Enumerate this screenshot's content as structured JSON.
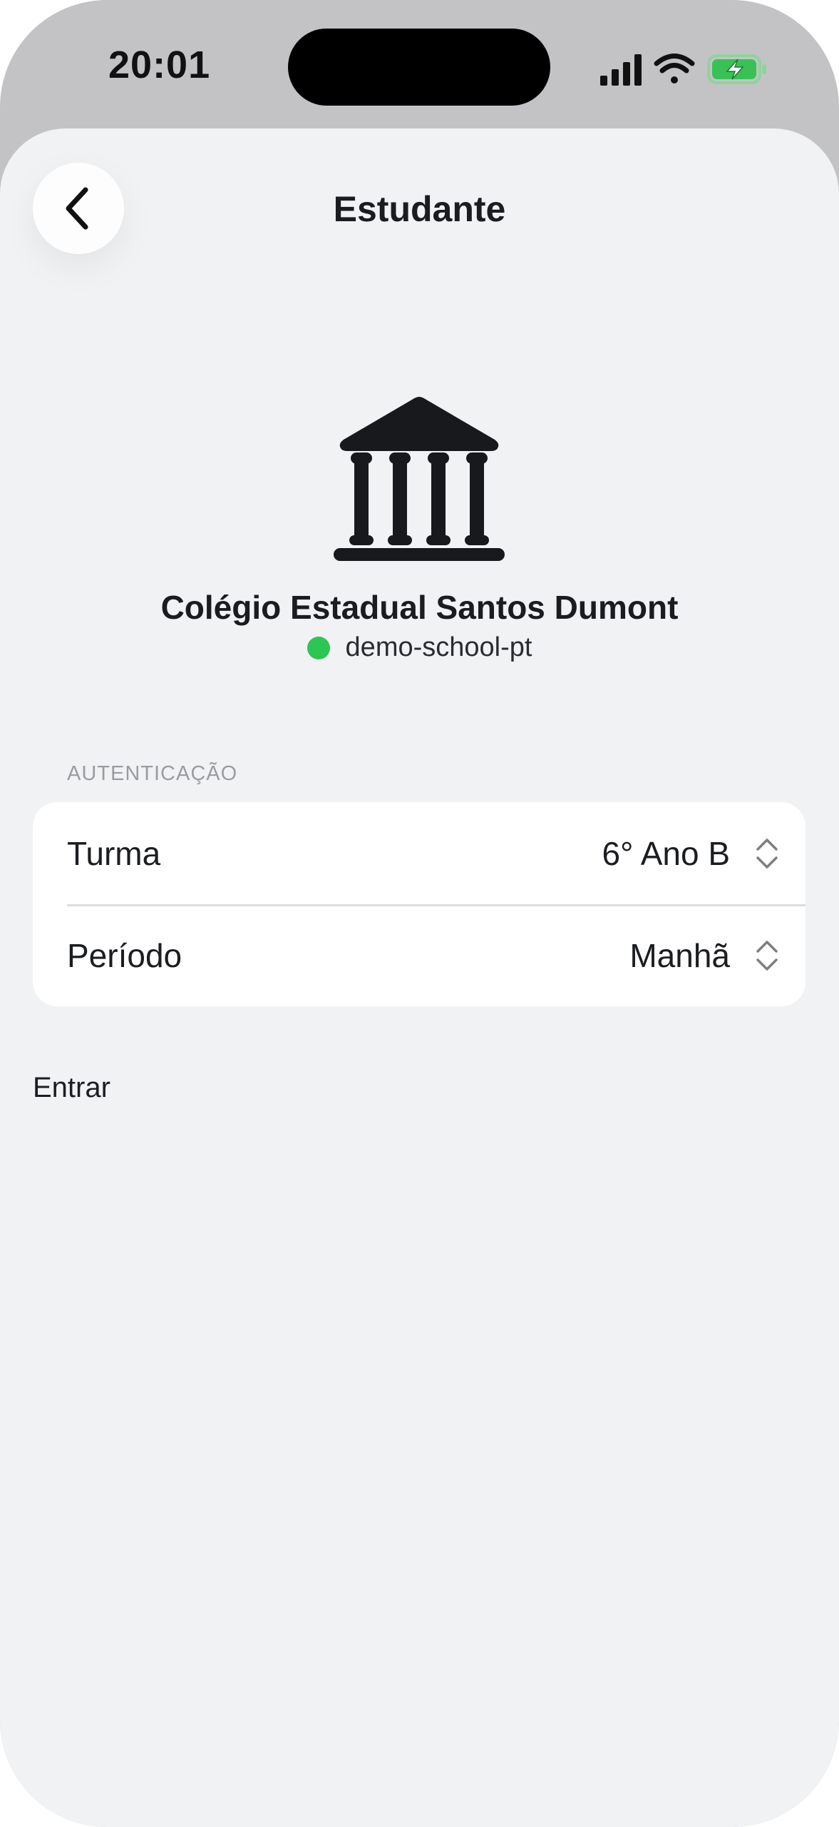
{
  "status_bar": {
    "time": "20:01",
    "icons": [
      "signal-icon",
      "wifi-icon",
      "battery-charging-icon"
    ]
  },
  "nav": {
    "title": "Estudante",
    "back_icon": "chevron-left-icon"
  },
  "school": {
    "icon": "institution-icon",
    "name": "Colégio Estadual Santos Dumont",
    "code": "demo-school-pt",
    "status_color": "#2dc553"
  },
  "auth": {
    "section_label": "AUTENTICAÇÃO",
    "rows": [
      {
        "label": "Turma",
        "value": "6° Ano B"
      },
      {
        "label": "Período",
        "value": "Manhã"
      }
    ]
  },
  "actions": {
    "enter_label": "Entrar"
  }
}
